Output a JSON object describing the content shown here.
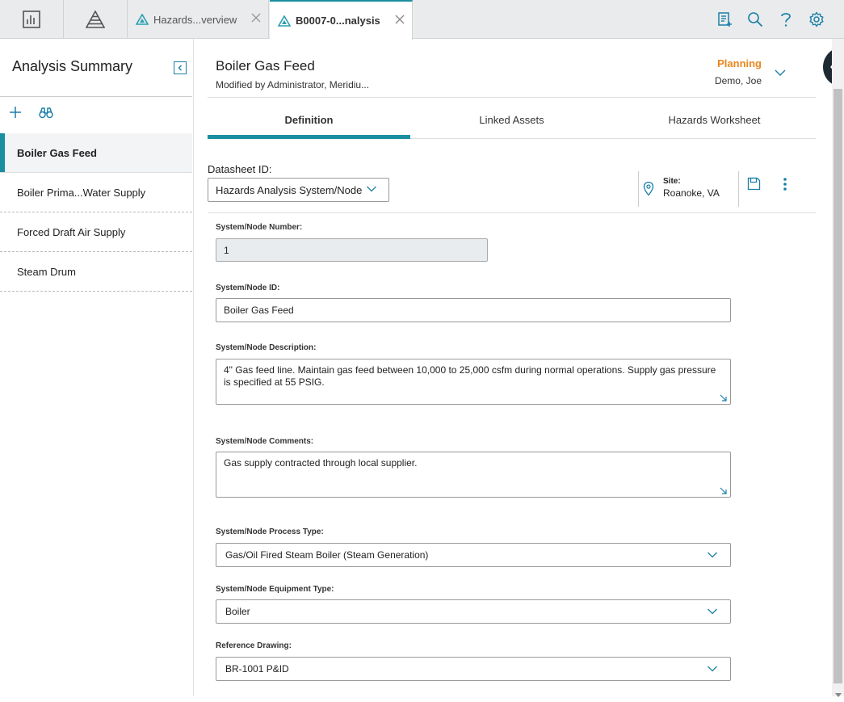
{
  "topbar": {
    "tabs": [
      {
        "label": "Hazards...verview",
        "active": false
      },
      {
        "label": "B0007-0...nalysis",
        "active": true
      }
    ],
    "icons": [
      "dashboard-icon",
      "asset-hierarchy-icon",
      "notes-icon",
      "search-icon",
      "help-icon",
      "settings-icon"
    ]
  },
  "sidebar": {
    "title": "Analysis Summary",
    "items": [
      {
        "label": "Boiler Gas Feed",
        "selected": true
      },
      {
        "label": "Boiler Prima...Water Supply",
        "selected": false
      },
      {
        "label": "Forced Draft Air Supply",
        "selected": false
      },
      {
        "label": "Steam Drum",
        "selected": false
      }
    ]
  },
  "record": {
    "title": "Boiler Gas Feed",
    "modified": "Modified by Administrator, Meridiu...",
    "state": "Planning",
    "owner": "Demo, Joe"
  },
  "tabs": [
    {
      "label": "Definition",
      "active": true
    },
    {
      "label": "Linked Assets",
      "active": false
    },
    {
      "label": "Hazards Worksheet",
      "active": false
    }
  ],
  "datasheet": {
    "label": "Datasheet ID:",
    "value": "Hazards Analysis System/Node",
    "site_label": "Site:",
    "site_value": "Roanoke, VA"
  },
  "fields": {
    "number": {
      "label": "System/Node Number:",
      "value": "1"
    },
    "id": {
      "label": "System/Node ID:",
      "value": "Boiler Gas Feed"
    },
    "description": {
      "label": "System/Node Description:",
      "value": "4\" Gas feed line. Maintain gas feed between 10,000 to 25,000 csfm during normal operations. Supply gas pressure is specified at 55 PSIG."
    },
    "comments": {
      "label": "System/Node Comments:",
      "value": "Gas supply contracted through local supplier."
    },
    "process_type": {
      "label": "System/Node Process Type:",
      "value": "Gas/Oil Fired Steam Boiler (Steam Generation)"
    },
    "equipment_type": {
      "label": "System/Node Equipment Type:",
      "value": "Boiler"
    },
    "drawing": {
      "label": "Reference Drawing:",
      "value": "BR-1001 P&ID"
    }
  },
  "colors": {
    "accent": "#1a8fa0",
    "state": "#e8871e",
    "icon_blue": "#1a7fa8"
  }
}
